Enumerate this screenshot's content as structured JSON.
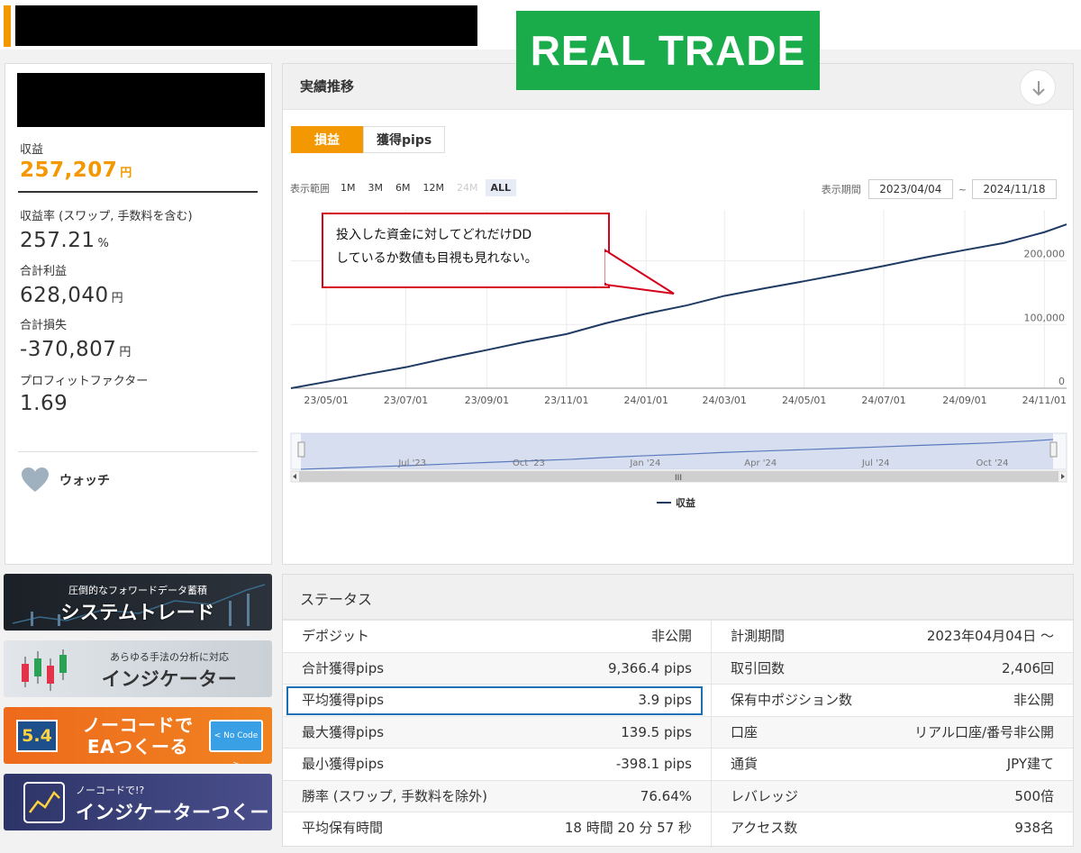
{
  "badge": "REAL TRADE",
  "left_panel": {
    "stats": [
      {
        "label": "収益",
        "value": "257,207",
        "unit": "円"
      },
      {
        "label": "収益率 (スワップ, 手数料を含む)",
        "value": "257.21",
        "unit": "%"
      },
      {
        "label": "合計利益",
        "value": "628,040",
        "unit": "円"
      },
      {
        "label": "合計損失",
        "value": "-370,807",
        "unit": "円"
      },
      {
        "label": "プロフィットファクター",
        "value": "1.69",
        "unit": ""
      }
    ],
    "watch_label": "ウォッチ"
  },
  "banners": {
    "b1": {
      "small": "圧倒的なフォワードデータ蓄積",
      "big": "システムトレード"
    },
    "b2": {
      "small": "あらゆる手法の分析に対応",
      "big": "インジケーター"
    },
    "b3": {
      "big1": "ノーコードで",
      "big2": "EAつくーる",
      "badge_text": "5.4",
      "code_text": "< No Code >"
    },
    "b4": {
      "small": "ノーコードで!?",
      "big": "インジケーターつくーる"
    }
  },
  "chart_panel": {
    "title": "実績推移",
    "tabs": [
      "損益",
      "獲得pips"
    ],
    "range_label": "表示範囲",
    "range_buttons": [
      "1M",
      "3M",
      "6M",
      "12M",
      "24M",
      "ALL"
    ],
    "period_label": "表示期間",
    "period_from": "2023/04/04",
    "period_sep": "~",
    "period_to": "2024/11/18",
    "navigator_labels": [
      "Jul '23",
      "Oct '23",
      "Jan '24",
      "Apr '24",
      "Jul '24",
      "Oct '24"
    ],
    "navigator_handle": "III"
  },
  "callout": {
    "line1": "投入した資金に対してどれだけDD",
    "line2": "しているか数値も目視も見れない。"
  },
  "chart_data": {
    "type": "line",
    "series": [
      {
        "name": "収益",
        "x": [
          "2023/04/04",
          "2023/05/01",
          "2023/06/01",
          "2023/07/01",
          "2023/08/01",
          "2023/09/01",
          "2023/10/01",
          "2023/11/01",
          "2023/12/01",
          "2024/01/01",
          "2024/02/01",
          "2024/03/01",
          "2024/04/01",
          "2024/05/01",
          "2024/06/01",
          "2024/07/01",
          "2024/08/01",
          "2024/09/01",
          "2024/10/01",
          "2024/11/01",
          "2024/11/18"
        ],
        "y": [
          0,
          10000,
          22000,
          33000,
          47000,
          60000,
          73000,
          85000,
          102000,
          117000,
          130000,
          145000,
          157000,
          168000,
          180000,
          192000,
          205000,
          217000,
          228000,
          245000,
          257207
        ]
      }
    ],
    "xticks": [
      "23/05/01",
      "23/07/01",
      "23/09/01",
      "23/11/01",
      "24/01/01",
      "24/03/01",
      "24/05/01",
      "24/07/01",
      "24/09/01",
      "24/11/01"
    ],
    "yticks": [
      "0",
      "100,000",
      "200,000"
    ],
    "ylim": [
      0,
      280000
    ],
    "legend": "bottom",
    "grid": true,
    "color": "#1f3a63"
  },
  "status": {
    "title": "ステータス",
    "rows": [
      {
        "k1": "デポジット",
        "v1": "非公開",
        "k2": "計測期間",
        "v2": "2023年04月04日 ～"
      },
      {
        "k1": "合計獲得pips",
        "v1": "9,366.4 pips",
        "k2": "取引回数",
        "v2": "2,406回"
      },
      {
        "k1": "平均獲得pips",
        "v1": "3.9 pips",
        "k2": "保有中ポジション数",
        "v2": "非公開"
      },
      {
        "k1": "最大獲得pips",
        "v1": "139.5 pips",
        "k2": "口座",
        "v2": "リアル口座/番号非公開"
      },
      {
        "k1": "最小獲得pips",
        "v1": "-398.1 pips",
        "k2": "通貨",
        "v2": "JPY建て"
      },
      {
        "k1": "勝率 (スワップ, 手数料を除外)",
        "v1": "76.64%",
        "k2": "レバレッジ",
        "v2": "500倍"
      },
      {
        "k1": "平均保有時間",
        "v1": "18 時間 20 分 57 秒",
        "k2": "アクセス数",
        "v2": "938名"
      }
    ]
  }
}
